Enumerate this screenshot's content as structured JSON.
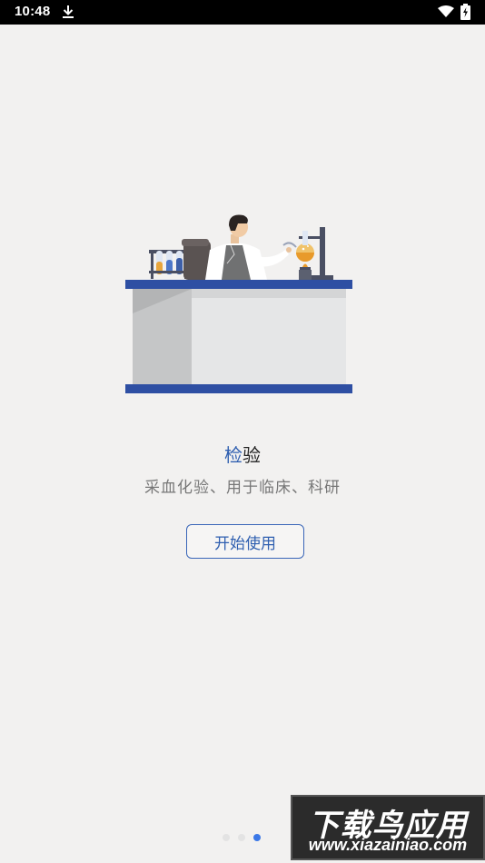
{
  "status_bar": {
    "time": "10:48",
    "icons": [
      "download-icon",
      "wifi-icon",
      "battery-charging-icon"
    ]
  },
  "onboarding": {
    "title_accent": "检",
    "title_rest": "验",
    "subtitle": "采血化验、用于临床、科研",
    "start_button_label": "开始使用",
    "page_count": 3,
    "current_page": 3
  },
  "watermark": {
    "title": "下载鸟应用",
    "url": "www.xiazainiao.com"
  },
  "colors": {
    "accent": "#2f5fb0",
    "page_background": "#f2f1f0",
    "active_dot": "#3b78e7",
    "inactive_dot": "#e3e3e3"
  }
}
